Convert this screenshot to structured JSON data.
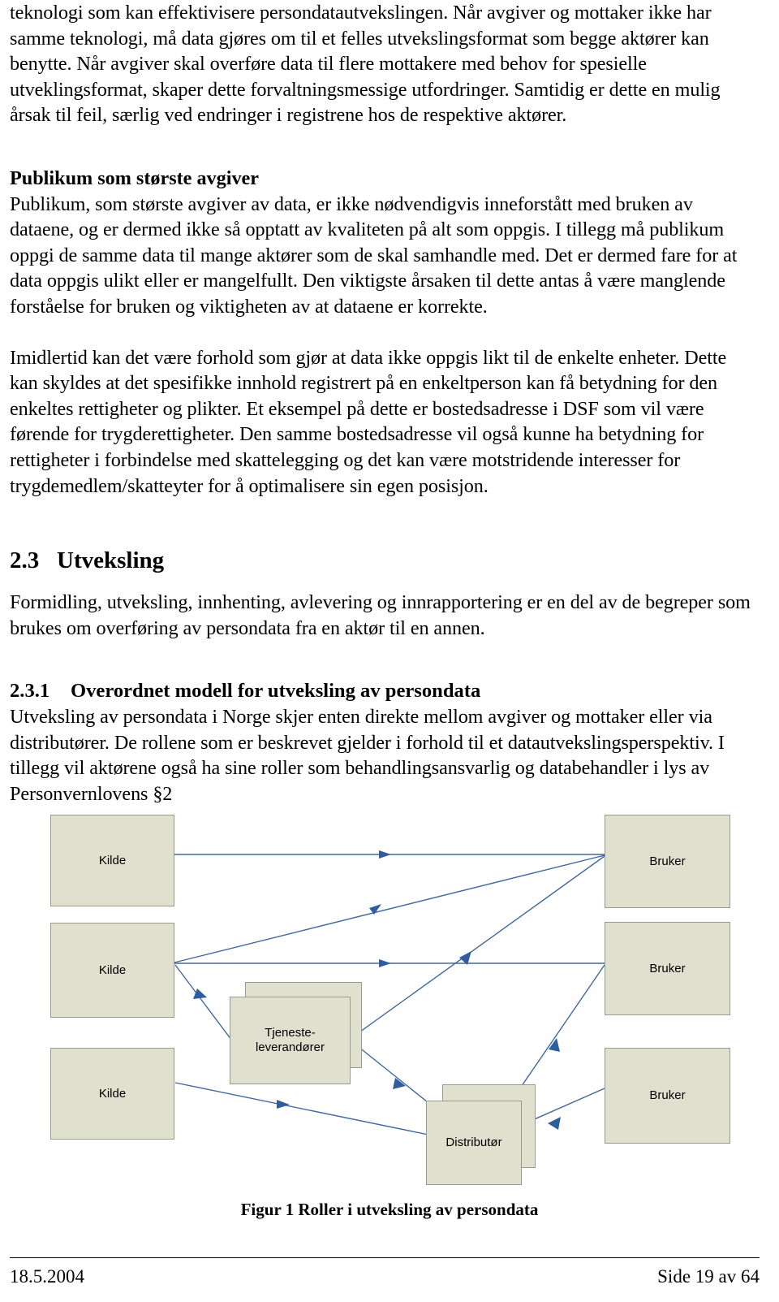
{
  "document": {
    "paragraphs": {
      "p1": "teknologi som kan effektivisere persondatautvekslingen. Når avgiver og mottaker ikke har samme teknologi, må data gjøres om til et felles utvekslingsformat som begge aktører kan benytte. Når avgiver skal overføre data til flere mottakere med behov for spesielle utveklingsformat, skaper dette forvaltningsmessige utfordringer. Samtidig er dette en mulig årsak til feil, særlig ved endringer i registrene hos de respektive aktører.",
      "publikum_heading": "Publikum som største avgiver",
      "p2": "Publikum, som største avgiver av data, er ikke nødvendigvis inneforstått med bruken av dataene, og er dermed ikke så opptatt av kvaliteten på alt som oppgis. I tillegg må publikum oppgi de samme data til mange aktører som de skal samhandle med. Det er dermed fare for at data oppgis ulikt eller er mangelfullt. Den viktigste årsaken til dette antas å være manglende forståelse for bruken og viktigheten av at dataene er korrekte.",
      "p3": "Imidlertid kan det være forhold som gjør at data ikke oppgis likt til de enkelte enheter. Dette kan skyldes at det spesifikke innhold registrert på en enkeltperson kan få betydning for den enkeltes rettigheter og plikter. Et eksempel på dette er bostedsadresse i DSF som vil være førende for trygderettigheter. Den samme bostedsadresse vil også kunne ha betydning for rettigheter i forbindelse med skattelegging og det kan være motstridende interesser for trygdemedlem/skatteyter for å optimalisere sin egen posisjon."
    },
    "section": {
      "number": "2.3",
      "title": "Utveksling",
      "body": "Formidling, utveksling, innhenting, avlevering og innrapportering er en del av de begreper som brukes om overføring av persondata fra en aktør til en annen."
    },
    "subsection": {
      "number": "2.3.1",
      "title": "Overordnet modell for utveksling av persondata",
      "body": "Utveksling av persondata i Norge skjer enten direkte mellom avgiver og mottaker eller via distributører. De rollene som er beskrevet gjelder i forhold til et datautvekslingsperspektiv. I tillegg vil aktørene også ha sine roller som behandlingsansvarlig og databehandler i lys av Personvernlovens §2"
    },
    "figure": {
      "caption": "Figur 1 Roller i utveksling av persondata",
      "nodes": {
        "kilde1": "Kilde",
        "kilde2": "Kilde",
        "kilde3": "Kilde",
        "bruker1": "Bruker",
        "bruker2": "Bruker",
        "bruker3": "Bruker",
        "tjenesteleverandorer": "Tjeneste-\nleverandører",
        "distributor": "Distributør"
      },
      "colors": {
        "node_fill": "#dfe1ce",
        "node_border": "#9a9a8e",
        "edge": "#41689e"
      }
    },
    "footer": {
      "date": "18.5.2004",
      "page": "Side 19 av 64"
    }
  }
}
